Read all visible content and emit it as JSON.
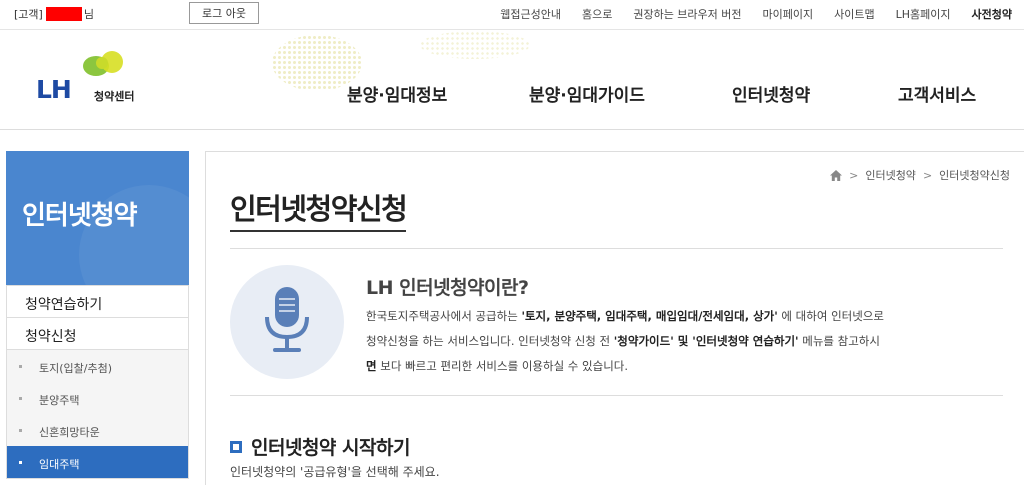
{
  "topbar": {
    "greeting_prefix": "[고객]",
    "greeting_suffix": "님",
    "logout_label": "로그 아웃",
    "links": [
      "웹접근성안내",
      "홈으로",
      "권장하는 브라우저 버전",
      "마이페이지",
      "사이트맵",
      "LH홈페이지",
      "사전청약"
    ]
  },
  "header": {
    "logo_text": "LH",
    "logo_sub": "청약센터",
    "nav": [
      "분양·임대정보",
      "분양·임대가이드",
      "인터넷청약",
      "고객서비스"
    ],
    "brand_colors": {
      "blue": "#1e4aa3",
      "green": "#8cc63f",
      "yellow": "#d7df23"
    }
  },
  "sidebar": {
    "title": "인터넷청약",
    "items": [
      "청약연습하기",
      "청약신청"
    ],
    "sub_items": [
      "토지(입찰/추첨)",
      "분양주택",
      "신혼희망타운",
      "임대주택"
    ],
    "active_sub": "임대주택",
    "accent": "#2d6dbf"
  },
  "content": {
    "breadcrumb": [
      "인터넷청약",
      "인터넷청약신청"
    ],
    "title": "인터넷청약신청",
    "intro_heading": "LH 인터넷청약이란?",
    "intro_p1_a": "한국토지주택공사에서 공급하는 ",
    "intro_p1_b": "'토지, 분양주택, 임대주택, 매입임대/전세임대, 상가'",
    "intro_p1_c": " 에 대하여 인터넷으로",
    "intro_p2_a": "청약신청을 하는 서비스입니다. 인터넷청약 신청 전 ",
    "intro_p2_b": "'청약가이드' 및 '인터넷청약 연습하기'",
    "intro_p2_c": " 메뉴를 참고하시",
    "intro_p3_a": "면",
    "intro_p3_b": " 보다 빠르고 편리한 서비스를 이용하실 수 있습니다.",
    "section_heading": "인터넷청약 시작하기",
    "section_text": "인터넷청약의 '공급유형'을 선택해 주세요."
  }
}
